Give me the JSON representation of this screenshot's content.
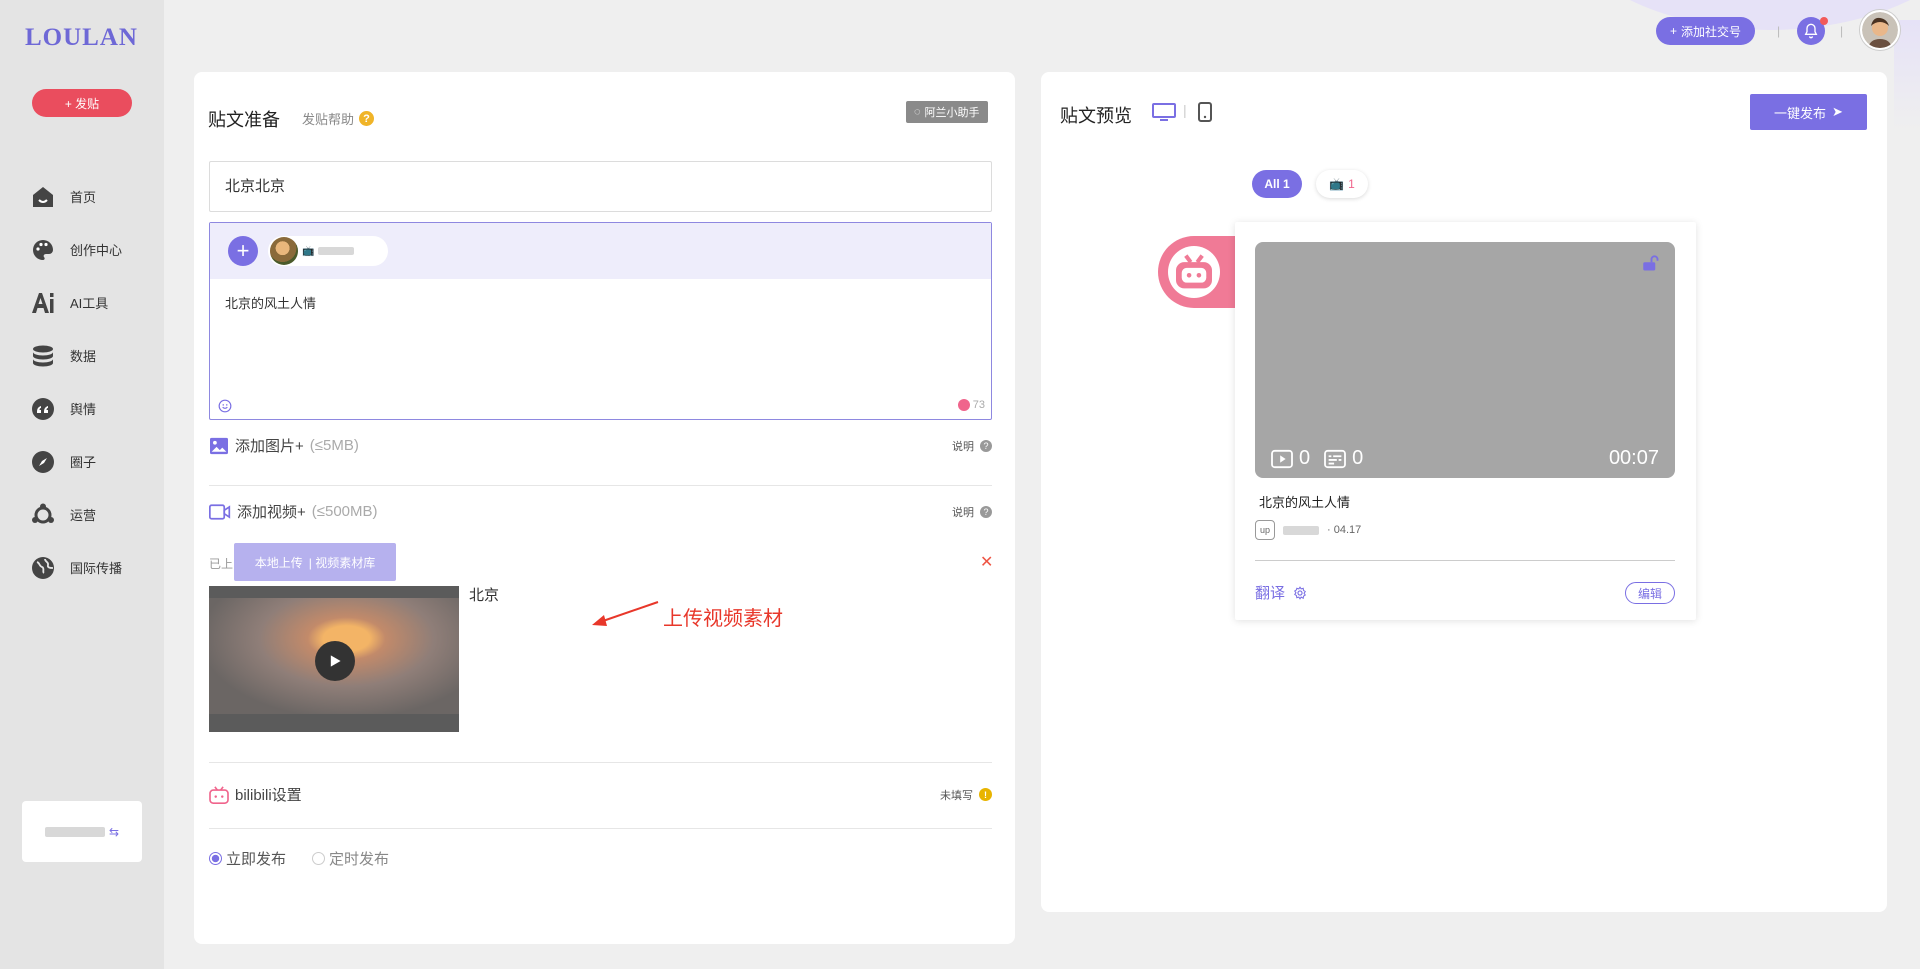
{
  "app": {
    "logo": "LOULAN",
    "post_button": "+ 发贴"
  },
  "sidebar": {
    "items": [
      {
        "label": "首页",
        "icon": "home-icon"
      },
      {
        "label": "创作中心",
        "icon": "palette-icon"
      },
      {
        "label": "AI工具",
        "icon": "ai-icon"
      },
      {
        "label": "数据",
        "icon": "database-icon"
      },
      {
        "label": "舆情",
        "icon": "quote-icon"
      },
      {
        "label": "圈子",
        "icon": "compass-icon"
      },
      {
        "label": "运营",
        "icon": "operations-icon"
      },
      {
        "label": "国际传播",
        "icon": "globe-icon"
      }
    ]
  },
  "topbar": {
    "add_social_label": "添加社交号"
  },
  "compose": {
    "title": "贴文准备",
    "help_label": "发贴帮助",
    "assistant_label": "阿兰小助手",
    "title_value": "北京北京",
    "body_text": "北京的风土人情",
    "char_count": "73",
    "add_image_label": "添加图片+",
    "add_image_limit": "(≤5MB)",
    "note_label": "说明",
    "add_video_label": "添加视频+",
    "add_video_limit": "(≤500MB)",
    "already_uploaded": "已上",
    "local_upload": "本地上传",
    "video_library": "| 视频素材库",
    "video_name": "北京",
    "annotation": "上传视频素材",
    "bili_settings": "bilibili设置",
    "unfilled": "未填写",
    "publish_now": "立即发布",
    "schedule_publish": "定时发布"
  },
  "preview": {
    "title": "贴文预览",
    "publish_button": "一键发布",
    "filter_all": "All 1",
    "filter_bili_count": "1",
    "play_count": "0",
    "comment_count": "0",
    "duration": "00:07",
    "card_title": "北京的风土人情",
    "date": "· 04.17",
    "translate": "翻译",
    "edit": "编辑"
  },
  "colors": {
    "accent": "#7a6fe3",
    "red": "#ea4d5e",
    "bilibili": "#f07a96"
  }
}
